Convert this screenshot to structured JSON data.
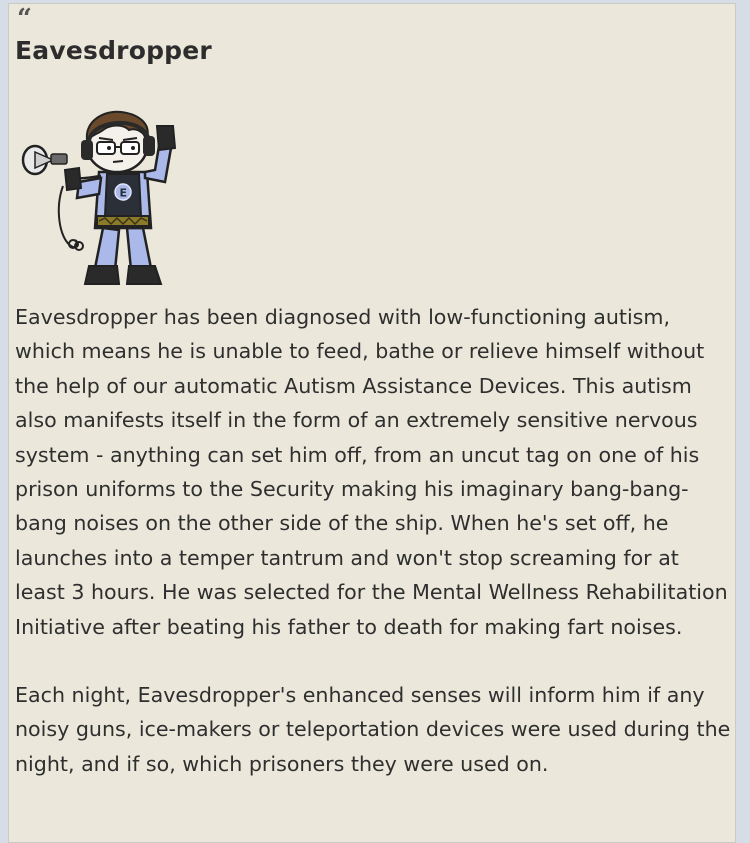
{
  "quote": {
    "mark": "“",
    "title": "Eavesdropper",
    "image": {
      "icon": "eavesdropper-character-icon",
      "skin_color": "#f4f0ea",
      "hair_color": "#6b4a2b",
      "suit_color": "#aab8ea",
      "shirt_color": "#2a2f38",
      "belt_color": "#8a7a2a",
      "boot_color": "#2a2a2a"
    },
    "paragraphs": [
      "Eavesdropper has been diagnosed with low-functioning autism, which means he is unable to feed, bathe or relieve himself without the help of our automatic Autism Assistance Devices. This autism also manifests itself in the form of an extremely sensitive nervous system - anything can set him off, from an uncut tag on one of his prison uniforms to the Security making his imaginary bang-bang-bang noises on the other side of the ship. When he's set off, he launches into a temper tantrum and won't stop screaming for at least 3 hours. He was selected for the Mental Wellness Rehabilitation Initiative after beating his father to death for making fart noises.",
      "Each night, Eavesdropper's enhanced senses will inform him if any noisy guns, ice-makers or teleportation devices were used during the night, and if so, which prisoners they were used on."
    ]
  }
}
